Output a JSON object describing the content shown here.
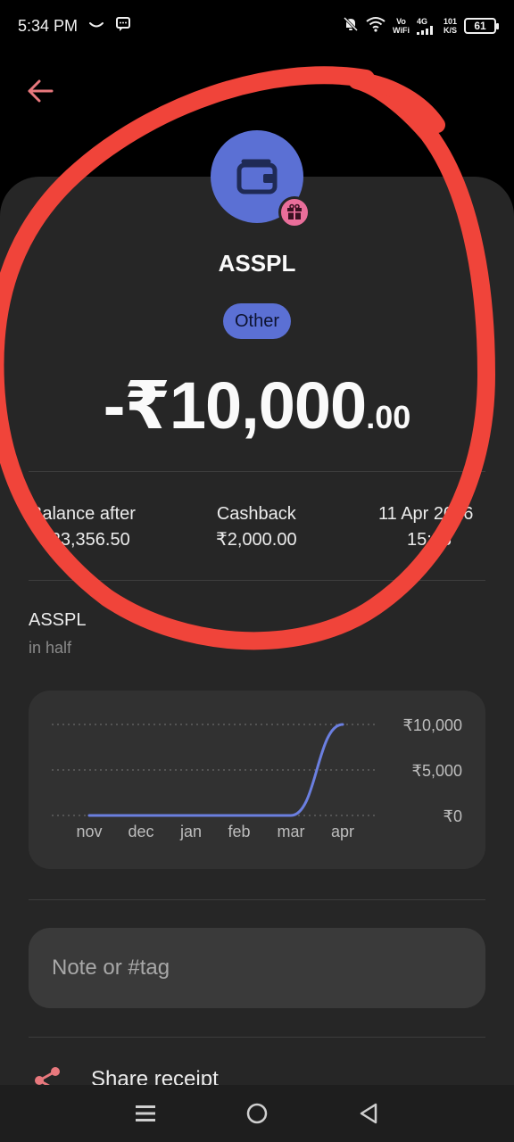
{
  "status_bar": {
    "time": "5:34 PM",
    "vo": "Vo",
    "wifi_label": "WiFi",
    "network": "4G",
    "speed_value": "101",
    "speed_unit": "K/S",
    "battery": "61"
  },
  "transaction": {
    "merchant": "ASSPL",
    "category": "Other",
    "amount_main": "-₹10,000",
    "amount_decimal": ".00"
  },
  "details": {
    "balance_label": "Balance after",
    "balance_value": "₹23,356.50",
    "cashback_label": "Cashback",
    "cashback_value": "₹2,000.00",
    "date_label": "11 Apr 2026",
    "time_value": "15:33"
  },
  "insight": {
    "title": "ASSPL",
    "subtitle": "in half"
  },
  "chart_data": {
    "type": "line",
    "categories": [
      "nov",
      "dec",
      "jan",
      "feb",
      "mar",
      "apr"
    ],
    "series": [
      {
        "values": [
          0,
          0,
          0,
          0,
          0,
          10000
        ]
      }
    ],
    "y_ticks": [
      "₹10,000",
      "₹5,000",
      "₹0"
    ],
    "ylim": [
      0,
      10000
    ],
    "grid": true,
    "line_color": "#6b7fe0"
  },
  "note": {
    "placeholder": "Note or #tag",
    "value": ""
  },
  "actions": {
    "share_label": "Share receipt"
  },
  "colors": {
    "accent": "#5b70d4",
    "back_arrow": "#e8787d",
    "annotation": "#f0443a",
    "gift_badge": "#e96e9a"
  },
  "icons": {
    "back": "arrow-left-icon",
    "merchant": "wallet-icon",
    "badge": "gift-icon",
    "share": "share-icon"
  }
}
